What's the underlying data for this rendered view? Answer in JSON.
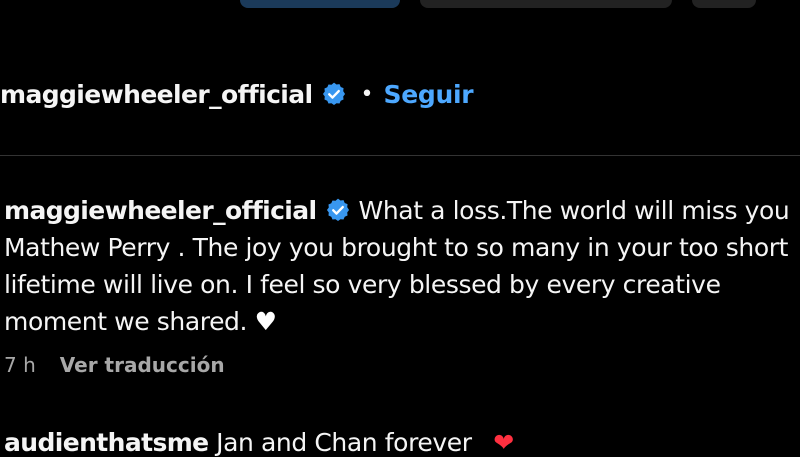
{
  "post_header": {
    "username": "maggiewheeler_official",
    "separator": "•",
    "follow_label": "Seguir"
  },
  "comment": {
    "username": "maggiewheeler_official",
    "text_line1": "What a loss.The world will miss you",
    "text_line2": "Mathew Perry . The joy you brought to so many in your too short",
    "text_line3": "lifetime will live on. I feel so very blessed by every creative",
    "text_line4": "moment we shared.",
    "heart": "♥",
    "time": "7 h",
    "translate_label": "Ver traducción"
  },
  "next_comment": {
    "username": "audienthatsme",
    "text": "Jan and Chan forever",
    "heart": "❤"
  },
  "colors": {
    "background": "#000000",
    "link_blue": "#4da8ff",
    "verified_blue": "#3897f0",
    "muted_text": "#a8a8a8"
  }
}
